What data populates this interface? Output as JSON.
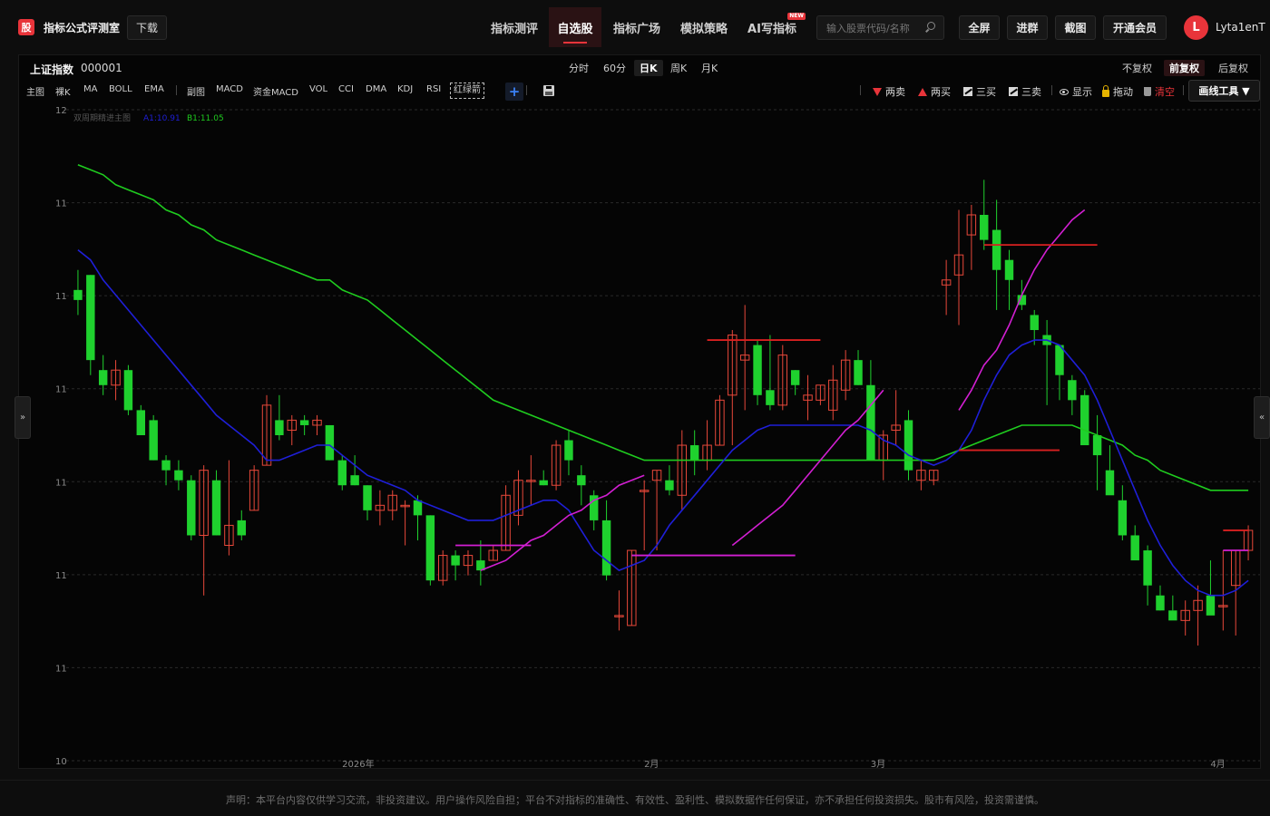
{
  "header": {
    "logo_char": "股",
    "app_title": "指标公式评测室",
    "download_label": "下载",
    "nav": [
      {
        "label": "指标测评",
        "active": false
      },
      {
        "label": "自选股",
        "active": true
      },
      {
        "label": "指标广场",
        "active": false
      },
      {
        "label": "模拟策略",
        "active": false
      },
      {
        "label": "AI写指标",
        "active": false,
        "badge": "NEW"
      }
    ],
    "search_placeholder": "输入股票代码/名称",
    "buttons": {
      "fullscreen": "全屏",
      "join_group": "进群",
      "screenshot": "截图",
      "vip": "开通会员"
    },
    "user": {
      "avatar_letter": "L",
      "name": "Lyta1enT"
    }
  },
  "chart_header": {
    "stock_name": "上证指数",
    "stock_code": "000001",
    "periods": [
      {
        "label": "分时",
        "active": false
      },
      {
        "label": "60分",
        "active": false
      },
      {
        "label": "日K",
        "active": true
      },
      {
        "label": "周K",
        "active": false
      },
      {
        "label": "月K",
        "active": false
      }
    ],
    "adjust": [
      {
        "label": "不复权",
        "active": false
      },
      {
        "label": "前复权",
        "active": true
      },
      {
        "label": "后复权",
        "active": false
      }
    ]
  },
  "indicators": {
    "main": [
      "主图",
      "裸K",
      "MA",
      "BOLL",
      "EMA"
    ],
    "sub": [
      "副图",
      "MACD",
      "资金MACD",
      "VOL",
      "CCI",
      "DMA",
      "KDJ",
      "RSI",
      "红绿箭"
    ]
  },
  "tools": {
    "two_sell": "两卖",
    "two_buy": "两买",
    "three_buy": "三买",
    "three_sell": "三卖",
    "show": "显示",
    "drag": "拖动",
    "clear": "清空",
    "draw_tools": "画线工具 ▼"
  },
  "side_arrows": {
    "left": "»",
    "right": "«"
  },
  "chart_data": {
    "type": "candlestick",
    "indicator_legend": {
      "name": "双周期精进主图",
      "a1": "A1:10.91",
      "b1": "B1:11.05"
    },
    "y_tick_labels": [
      "12",
      "11",
      "11",
      "11",
      "11",
      "11",
      "11",
      "10"
    ],
    "x_tick_labels": [
      "2026年",
      "2月",
      "3月",
      "4月"
    ],
    "ylim": [
      10.7,
      12.0
    ],
    "grid": true,
    "colors": {
      "up": "#e8483a",
      "down": "#1fd12e",
      "line_blue": "#1f1fd8",
      "line_green": "#1fcc1f",
      "line_magenta": "#d21fd2",
      "line_red": "#d82020"
    },
    "candles": [
      [
        11.64,
        11.68,
        11.59,
        11.62
      ],
      [
        11.67,
        11.67,
        11.47,
        11.5
      ],
      [
        11.48,
        11.51,
        11.43,
        11.45
      ],
      [
        11.45,
        11.5,
        11.42,
        11.48
      ],
      [
        11.48,
        11.49,
        11.39,
        11.4
      ],
      [
        11.4,
        11.41,
        11.35,
        11.35
      ],
      [
        11.38,
        11.39,
        11.3,
        11.3
      ],
      [
        11.3,
        11.31,
        11.25,
        11.28
      ],
      [
        11.28,
        11.3,
        11.24,
        11.26
      ],
      [
        11.26,
        11.27,
        11.14,
        11.15
      ],
      [
        11.15,
        11.29,
        11.03,
        11.28
      ],
      [
        11.26,
        11.28,
        11.15,
        11.15
      ],
      [
        11.13,
        11.3,
        11.11,
        11.17
      ],
      [
        11.18,
        11.2,
        11.14,
        11.15
      ],
      [
        11.2,
        11.29,
        11.2,
        11.28
      ],
      [
        11.29,
        11.43,
        11.29,
        11.41
      ],
      [
        11.38,
        11.43,
        11.34,
        11.35
      ],
      [
        11.36,
        11.39,
        11.33,
        11.38
      ],
      [
        11.38,
        11.39,
        11.35,
        11.37
      ],
      [
        11.37,
        11.39,
        11.35,
        11.38
      ],
      [
        11.37,
        11.37,
        11.3,
        11.3
      ],
      [
        11.3,
        11.31,
        11.24,
        11.25
      ],
      [
        11.27,
        11.31,
        11.25,
        11.25
      ],
      [
        11.25,
        11.25,
        11.18,
        11.2
      ],
      [
        11.2,
        11.24,
        11.17,
        11.21
      ],
      [
        11.2,
        11.24,
        11.18,
        11.23
      ],
      [
        11.21,
        11.22,
        11.13,
        11.21
      ],
      [
        11.22,
        11.23,
        11.14,
        11.19
      ],
      [
        11.19,
        11.19,
        11.05,
        11.06
      ],
      [
        11.06,
        11.12,
        11.05,
        11.11
      ],
      [
        11.11,
        11.12,
        11.06,
        11.09
      ],
      [
        11.09,
        11.12,
        11.07,
        11.11
      ],
      [
        11.1,
        11.14,
        11.05,
        11.08
      ],
      [
        11.1,
        11.13,
        11.1,
        11.12
      ],
      [
        11.12,
        11.25,
        11.12,
        11.23
      ],
      [
        11.19,
        11.28,
        11.17,
        11.26
      ],
      [
        11.26,
        11.31,
        11.21,
        11.26
      ],
      [
        11.26,
        11.28,
        11.25,
        11.25
      ],
      [
        11.25,
        11.34,
        11.24,
        11.33
      ],
      [
        11.34,
        11.36,
        11.27,
        11.3
      ],
      [
        11.27,
        11.29,
        11.21,
        11.25
      ],
      [
        11.23,
        11.24,
        11.16,
        11.18
      ],
      [
        11.18,
        11.22,
        11.06,
        11.07
      ],
      [
        10.99,
        11.04,
        10.96,
        10.99
      ],
      [
        10.97,
        11.12,
        10.97,
        11.12
      ],
      [
        11.24,
        11.26,
        11.12,
        11.24
      ],
      [
        11.26,
        11.28,
        11.12,
        11.28
      ],
      [
        11.26,
        11.29,
        11.23,
        11.24
      ],
      [
        11.23,
        11.36,
        11.2,
        11.33
      ],
      [
        11.33,
        11.36,
        11.27,
        11.3
      ],
      [
        11.3,
        11.38,
        11.28,
        11.33
      ],
      [
        11.33,
        11.43,
        11.33,
        11.42
      ],
      [
        11.43,
        11.56,
        11.33,
        11.55
      ],
      [
        11.5,
        11.61,
        11.4,
        11.51
      ],
      [
        11.53,
        11.54,
        11.41,
        11.43
      ],
      [
        11.44,
        11.55,
        11.4,
        11.41
      ],
      [
        11.41,
        11.53,
        11.4,
        11.51
      ],
      [
        11.48,
        11.48,
        11.43,
        11.45
      ],
      [
        11.42,
        11.47,
        11.38,
        11.43
      ],
      [
        11.42,
        11.45,
        11.41,
        11.45
      ],
      [
        11.4,
        11.49,
        11.38,
        11.46
      ],
      [
        11.44,
        11.52,
        11.42,
        11.5
      ],
      [
        11.5,
        11.52,
        11.45,
        11.45
      ],
      [
        11.45,
        11.5,
        11.3,
        11.3
      ],
      [
        11.3,
        11.36,
        11.26,
        11.35
      ],
      [
        11.36,
        11.44,
        11.33,
        11.37
      ],
      [
        11.38,
        11.4,
        11.26,
        11.28
      ],
      [
        11.26,
        11.3,
        11.24,
        11.28
      ],
      [
        11.26,
        11.28,
        11.25,
        11.28
      ],
      [
        11.65,
        11.7,
        11.59,
        11.66
      ],
      [
        11.67,
        11.8,
        11.57,
        11.71
      ],
      [
        11.75,
        11.81,
        11.68,
        11.79
      ],
      [
        11.79,
        11.86,
        11.72,
        11.74
      ],
      [
        11.76,
        11.82,
        11.6,
        11.68
      ],
      [
        11.7,
        11.72,
        11.6,
        11.66
      ],
      [
        11.63,
        11.66,
        11.6,
        11.61
      ],
      [
        11.59,
        11.6,
        11.53,
        11.56
      ],
      [
        11.55,
        11.58,
        11.41,
        11.53
      ],
      [
        11.53,
        11.53,
        11.42,
        11.47
      ],
      [
        11.46,
        11.47,
        11.39,
        11.42
      ],
      [
        11.43,
        11.44,
        11.36,
        11.33
      ],
      [
        11.35,
        11.39,
        11.24,
        11.31
      ],
      [
        11.28,
        11.33,
        11.24,
        11.23
      ],
      [
        11.22,
        11.25,
        11.14,
        11.15
      ],
      [
        11.15,
        11.17,
        11.12,
        11.1
      ],
      [
        11.12,
        11.13,
        11.01,
        11.05
      ],
      [
        11.03,
        11.05,
        11.0,
        11.0
      ],
      [
        11.0,
        11.03,
        11.0,
        10.98
      ],
      [
        10.98,
        11.02,
        10.95,
        11.0
      ],
      [
        11.0,
        11.05,
        10.93,
        11.02
      ],
      [
        11.03,
        11.1,
        11.0,
        10.99
      ],
      [
        11.01,
        11.12,
        10.96,
        11.01
      ],
      [
        11.05,
        11.12,
        10.95,
        11.12
      ],
      [
        11.12,
        11.17,
        11.1,
        11.16
      ]
    ],
    "ma_blue": [
      11.72,
      11.7,
      11.66,
      11.63,
      11.6,
      11.57,
      11.54,
      11.51,
      11.48,
      11.45,
      11.42,
      11.39,
      11.37,
      11.35,
      11.33,
      11.3,
      11.3,
      11.31,
      11.32,
      11.33,
      11.33,
      11.31,
      11.29,
      11.27,
      11.26,
      11.25,
      11.24,
      11.22,
      11.21,
      11.2,
      11.19,
      11.18,
      11.18,
      11.18,
      11.19,
      11.2,
      11.21,
      11.22,
      11.22,
      11.2,
      11.16,
      11.12,
      11.1,
      11.08,
      11.09,
      11.1,
      11.13,
      11.17,
      11.2,
      11.23,
      11.26,
      11.29,
      11.32,
      11.34,
      11.36,
      11.37,
      11.37,
      11.37,
      11.37,
      11.37,
      11.37,
      11.37,
      11.37,
      11.36,
      11.34,
      11.33,
      11.31,
      11.3,
      11.29,
      11.3,
      11.32,
      11.36,
      11.42,
      11.47,
      11.51,
      11.53,
      11.54,
      11.54,
      11.53,
      11.5,
      11.47,
      11.42,
      11.36,
      11.3,
      11.24,
      11.18,
      11.13,
      11.09,
      11.06,
      11.04,
      11.03,
      11.03,
      11.04,
      11.06
    ],
    "ma_green": [
      11.89,
      11.88,
      11.87,
      11.85,
      11.84,
      11.83,
      11.82,
      11.8,
      11.79,
      11.77,
      11.76,
      11.74,
      11.73,
      11.72,
      11.71,
      11.7,
      11.69,
      11.68,
      11.67,
      11.66,
      11.66,
      11.64,
      11.63,
      11.62,
      11.6,
      11.58,
      11.56,
      11.54,
      11.52,
      11.5,
      11.48,
      11.46,
      11.44,
      11.42,
      11.41,
      11.4,
      11.39,
      11.38,
      11.37,
      11.36,
      11.35,
      11.34,
      11.33,
      11.32,
      11.31,
      11.3,
      11.3,
      11.3,
      11.3,
      11.3,
      11.3,
      11.3,
      11.3,
      11.3,
      11.3,
      11.3,
      11.3,
      11.3,
      11.3,
      11.3,
      11.3,
      11.3,
      11.3,
      11.3,
      11.3,
      11.3,
      11.3,
      11.3,
      11.3,
      11.31,
      11.32,
      11.33,
      11.34,
      11.35,
      11.36,
      11.37,
      11.37,
      11.37,
      11.37,
      11.37,
      11.36,
      11.35,
      11.34,
      11.33,
      11.31,
      11.3,
      11.28,
      11.27,
      11.26,
      11.25,
      11.24,
      11.24,
      11.24,
      11.24
    ],
    "ma_magenta_start_index": 32,
    "ma_magenta": [
      11.08,
      11.09,
      11.1,
      11.12,
      11.14,
      11.15,
      11.17,
      11.19,
      11.2,
      11.22,
      11.23,
      11.25,
      11.26,
      11.27
    ],
    "ma_magenta_2_start_index": 52,
    "ma_magenta_2": [
      11.13,
      11.15,
      11.17,
      11.19,
      11.21,
      11.24,
      11.27,
      11.3,
      11.33,
      11.36,
      11.38,
      11.41,
      11.44
    ],
    "ma_magenta_3_start_index": 70,
    "ma_magenta_3": [
      11.4,
      11.44,
      11.49,
      11.52,
      11.57,
      11.63,
      11.68,
      11.72,
      11.75,
      11.78,
      11.8
    ],
    "levels": [
      {
        "color": "magenta",
        "start": 30,
        "end": 36,
        "value": 11.13
      },
      {
        "color": "magenta",
        "start": 44,
        "end": 57,
        "value": 11.11
      },
      {
        "color": "red",
        "start": 50,
        "end": 59,
        "value": 11.54
      },
      {
        "color": "red",
        "start": 70,
        "end": 78,
        "value": 11.32
      },
      {
        "color": "red",
        "start": 72,
        "end": 81,
        "value": 11.73
      },
      {
        "color": "magenta",
        "start": 91,
        "end": 93,
        "value": 11.12
      },
      {
        "color": "red",
        "start": 91,
        "end": 93,
        "value": 11.16
      }
    ]
  },
  "footer": {
    "disclaimer": "声明：本平台内容仅供学习交流，非投资建议。用户操作风险自担；平台不对指标的准确性、有效性、盈利性、模拟数据作任何保证，亦不承担任何投资损失。股市有风险，投资需谨慎。"
  }
}
